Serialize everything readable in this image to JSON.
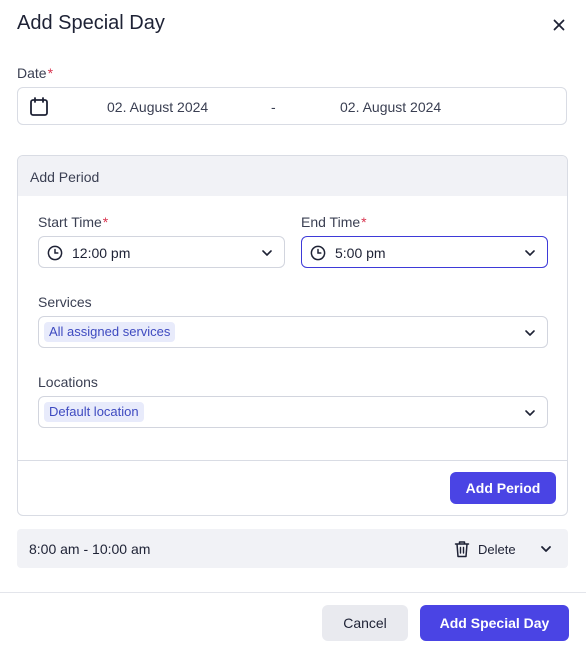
{
  "dialog": {
    "title": "Add Special Day"
  },
  "date": {
    "label": "Date",
    "required_mark": "*",
    "start": "02. August 2024",
    "separator": "-",
    "end": "02. August 2024"
  },
  "period": {
    "header": "Add Period",
    "start_time": {
      "label": "Start Time",
      "required_mark": "*",
      "value": "12:00 pm"
    },
    "end_time": {
      "label": "End Time",
      "required_mark": "*",
      "value": "5:00 pm"
    },
    "services": {
      "label": "Services",
      "tag": "All assigned services"
    },
    "locations": {
      "label": "Locations",
      "tag": "Default location"
    },
    "add_button": "Add Period"
  },
  "periods_list": [
    {
      "range": "8:00 am - 10:00 am",
      "delete_label": "Delete"
    }
  ],
  "footer": {
    "cancel": "Cancel",
    "submit": "Add Special Day"
  },
  "colors": {
    "primary": "#4a44e4",
    "required": "#d8344f",
    "tag_bg": "#e8ebfb",
    "tag_text": "#3e4ac0"
  },
  "icons": [
    "close-icon",
    "calendar-icon",
    "clock-icon",
    "chevron-down-icon",
    "trash-icon"
  ]
}
